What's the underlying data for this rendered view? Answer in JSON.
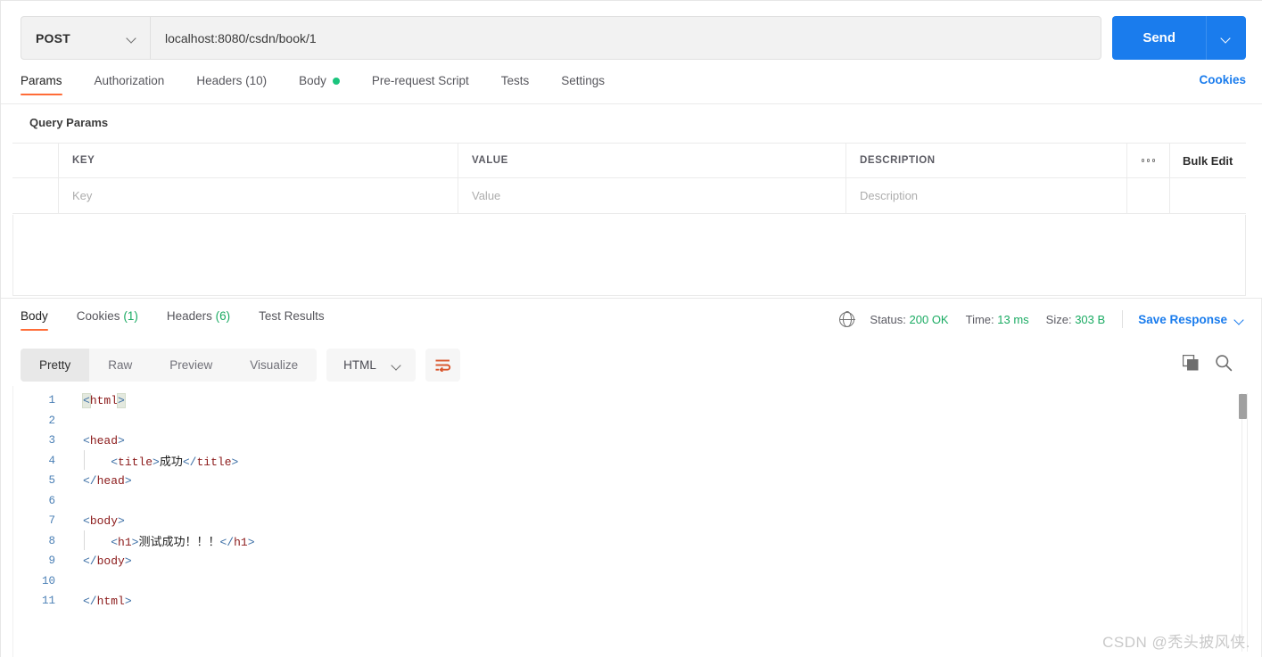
{
  "request": {
    "method": "POST",
    "url": "localhost:8080/csdn/book/1",
    "send_label": "Send",
    "tabs": [
      {
        "label": "Params",
        "active": true,
        "dot": false
      },
      {
        "label": "Authorization",
        "active": false,
        "dot": false
      },
      {
        "label": "Headers (10)",
        "active": false,
        "dot": false
      },
      {
        "label": "Body",
        "active": false,
        "dot": true
      },
      {
        "label": "Pre-request Script",
        "active": false,
        "dot": false
      },
      {
        "label": "Tests",
        "active": false,
        "dot": false
      },
      {
        "label": "Settings",
        "active": false,
        "dot": false
      }
    ],
    "cookies_link": "Cookies"
  },
  "query_params": {
    "title": "Query Params",
    "headers": {
      "key": "KEY",
      "value": "VALUE",
      "description": "DESCRIPTION",
      "bulk_edit": "Bulk Edit"
    },
    "row": {
      "key_placeholder": "Key",
      "value_placeholder": "Value",
      "description_placeholder": "Description"
    }
  },
  "response": {
    "tabs": [
      {
        "label": "Body",
        "count": "",
        "active": true
      },
      {
        "label": "Cookies",
        "count": "(1)",
        "active": false
      },
      {
        "label": "Headers",
        "count": "(6)",
        "active": false
      },
      {
        "label": "Test Results",
        "count": "",
        "active": false
      }
    ],
    "meta": {
      "status_label": "Status:",
      "status_value": "200 OK",
      "time_label": "Time:",
      "time_value": "13 ms",
      "size_label": "Size:",
      "size_value": "303 B",
      "save_response": "Save Response"
    },
    "view_modes": [
      {
        "label": "Pretty",
        "active": true
      },
      {
        "label": "Raw",
        "active": false
      },
      {
        "label": "Preview",
        "active": false
      },
      {
        "label": "Visualize",
        "active": false
      }
    ],
    "format": "HTML",
    "body_lines": [
      {
        "n": "1",
        "indent": false,
        "parts": [
          {
            "t": "<",
            "c": "tag-br mark"
          },
          {
            "t": "html",
            "c": "tag-nm"
          },
          {
            "t": ">",
            "c": "tag-br mark"
          }
        ]
      },
      {
        "n": "2",
        "indent": false,
        "parts": []
      },
      {
        "n": "3",
        "indent": false,
        "parts": [
          {
            "t": "<",
            "c": "tag-br"
          },
          {
            "t": "head",
            "c": "tag-nm"
          },
          {
            "t": ">",
            "c": "tag-br"
          }
        ]
      },
      {
        "n": "4",
        "indent": true,
        "parts": [
          {
            "t": "    ",
            "c": "tag-br"
          },
          {
            "t": "<",
            "c": "tag-br"
          },
          {
            "t": "title",
            "c": "tag-nm"
          },
          {
            "t": ">",
            "c": "tag-br"
          },
          {
            "t": "成功",
            "c": "txt-cn"
          },
          {
            "t": "</",
            "c": "tag-br"
          },
          {
            "t": "title",
            "c": "tag-nm"
          },
          {
            "t": ">",
            "c": "tag-br"
          }
        ]
      },
      {
        "n": "5",
        "indent": false,
        "parts": [
          {
            "t": "</",
            "c": "tag-br"
          },
          {
            "t": "head",
            "c": "tag-nm"
          },
          {
            "t": ">",
            "c": "tag-br"
          }
        ]
      },
      {
        "n": "6",
        "indent": false,
        "parts": []
      },
      {
        "n": "7",
        "indent": false,
        "parts": [
          {
            "t": "<",
            "c": "tag-br"
          },
          {
            "t": "body",
            "c": "tag-nm"
          },
          {
            "t": ">",
            "c": "tag-br"
          }
        ]
      },
      {
        "n": "8",
        "indent": true,
        "parts": [
          {
            "t": "    ",
            "c": "tag-br"
          },
          {
            "t": "<",
            "c": "tag-br"
          },
          {
            "t": "h1",
            "c": "tag-nm"
          },
          {
            "t": ">",
            "c": "tag-br"
          },
          {
            "t": "测试成功！！！",
            "c": "txt-cn"
          },
          {
            "t": "</",
            "c": "tag-br"
          },
          {
            "t": "h1",
            "c": "tag-nm"
          },
          {
            "t": ">",
            "c": "tag-br"
          }
        ]
      },
      {
        "n": "9",
        "indent": false,
        "parts": [
          {
            "t": "</",
            "c": "tag-br"
          },
          {
            "t": "body",
            "c": "tag-nm"
          },
          {
            "t": ">",
            "c": "tag-br"
          }
        ]
      },
      {
        "n": "10",
        "indent": false,
        "parts": []
      },
      {
        "n": "11",
        "indent": false,
        "parts": [
          {
            "t": "</",
            "c": "tag-br"
          },
          {
            "t": "html",
            "c": "tag-nm"
          },
          {
            "t": ">",
            "c": "tag-br"
          }
        ]
      }
    ]
  },
  "icons": {
    "method_chevron": "chevron-down-icon",
    "send_chevron": "chevron-down-icon",
    "body_indicator": "green-dot-icon",
    "more_options": "ellipsis-icon",
    "globe": "globe-icon",
    "format_chevron": "chevron-down-icon",
    "word_wrap": "word-wrap-icon",
    "copy": "copy-icon",
    "search": "search-icon",
    "save_chevron": "chevron-down-icon"
  },
  "colors": {
    "accent_orange": "#ff6c37",
    "primary_blue": "#1a7ced",
    "success_green": "#1bab63",
    "dot_green": "#1bc47d"
  },
  "watermark": "CSDN @秃头披风侠."
}
